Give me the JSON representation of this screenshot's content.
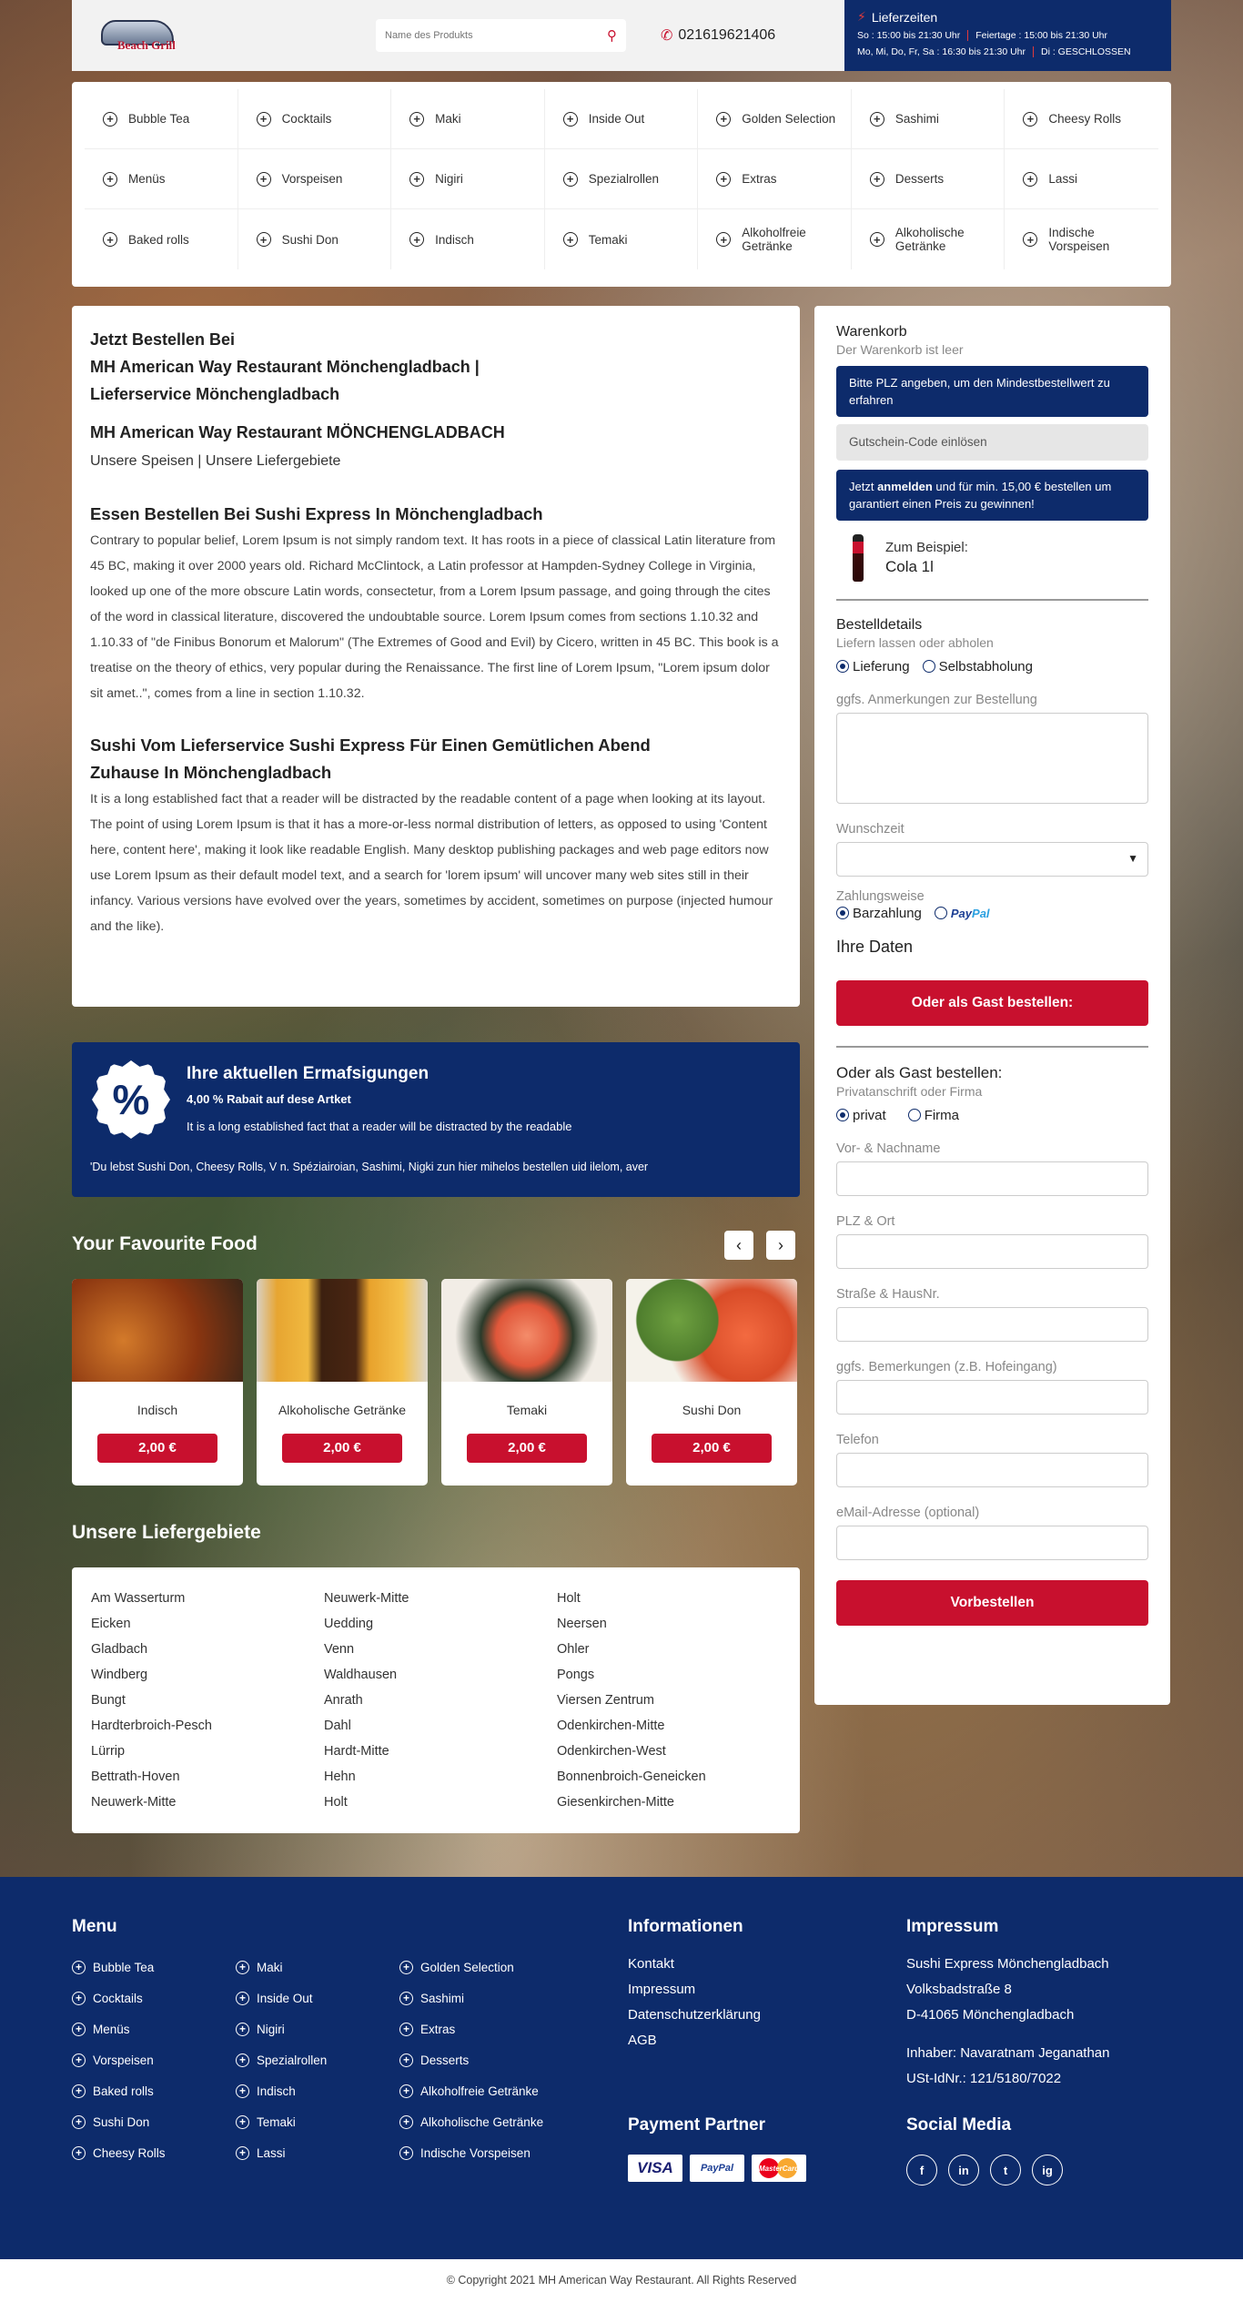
{
  "header": {
    "logo_text": "Beach Grill",
    "search_placeholder": "Name des Produkts",
    "phone": "021619621406",
    "times": {
      "title": "Lieferzeiten",
      "row1_a": "So : 15:00 bis 21:30 Uhr",
      "row1_b": "Feiertage : 15:00 bis 21:30 Uhr",
      "row2_a": "Mo, Mi, Do, Fr, Sa : 16:30 bis 21:30 Uhr",
      "row2_b": "Di : GESCHLOSSEN"
    }
  },
  "categories": [
    "Bubble Tea",
    "Cocktails",
    "Maki",
    "Inside Out",
    "Golden Selection",
    "Sashimi",
    "Cheesy Rolls",
    "Menüs",
    "Vorspeisen",
    "Nigiri",
    "Spezialrollen",
    "Extras",
    "Desserts",
    "Lassi",
    "Baked rolls",
    "Sushi Don",
    "Indisch",
    "Temaki",
    "Alkoholfreie Getränke",
    "Alkoholische Getränke",
    "Indische Vorspeisen"
  ],
  "main": {
    "h1_line1": "Jetzt Bestellen Bei",
    "h1_line2": "MH American Way Restaurant Mönchengladbach |",
    "h1_line3": "Lieferservice Mönchengladbach",
    "h2": "MH American Way Restaurant MÖNCHENGLADBACH",
    "links": "Unsere Speisen | Unsere Liefergebiete",
    "h3": "Essen Bestellen Bei Sushi Express In Mönchengladbach",
    "p1": "Contrary to popular belief, Lorem Ipsum is not simply random text. It has roots in a piece of classical Latin literature from 45 BC, making it over 2000 years old. Richard McClintock, a Latin professor at Hampden-Sydney College in Virginia, looked up one of the more obscure Latin words, consectetur, from a Lorem Ipsum passage, and going through the cites of the word in classical literature, discovered the undoubtable source. Lorem Ipsum comes from sections 1.10.32 and 1.10.33 of \"de Finibus Bonorum et Malorum\" (The Extremes of Good and Evil) by Cicero, written in 45 BC. This book is a treatise on the theory of ethics, very popular during the Renaissance. The first line of Lorem Ipsum, \"Lorem ipsum dolor sit amet..\", comes from a line in section 1.10.32.",
    "h4_line1": "Sushi Vom Lieferservice Sushi Express Für Einen Gemütlichen Abend",
    "h4_line2": "Zuhause In Mönchengladbach",
    "p2": "It is a long established fact that a reader will be distracted by the readable content of a page when looking at its layout. The point of using Lorem Ipsum is that it has a more-or-less normal distribution of letters, as opposed to using 'Content here, content here', making it look like readable English. Many desktop publishing packages and web page editors now use Lorem Ipsum as their default model text, and a search for 'lorem ipsum' will uncover many web sites still in their infancy. Various versions have evolved over the years, sometimes by accident, sometimes on purpose (injected humour and the like)."
  },
  "promo": {
    "badge": "%",
    "title": "Ihre aktuellen Ermafsigungen",
    "sub1": "4,00 % Rabait auf dese Artket",
    "sub2": "It is a long established fact that a reader will be distracted by the readable",
    "sub3": "'Du lebst Sushi Don, Cheesy Rolls, V n. Spéziairoian, Sashimi, Nigki zun hier mihelos bestellen uid ilelom, aver"
  },
  "favourite": {
    "title": "Your Favourite Food",
    "prev": "‹",
    "next": "›",
    "items": [
      {
        "name": "Indisch",
        "price": "2,00 €"
      },
      {
        "name": "Alkoholische Getränke",
        "price": "2,00 €"
      },
      {
        "name": "Temaki",
        "price": "2,00 €"
      },
      {
        "name": "Sushi Don",
        "price": "2,00 €"
      }
    ]
  },
  "areas": {
    "title": "Unsere Liefergebiete",
    "col1": [
      "Am Wasserturm",
      "Eicken",
      "Gladbach",
      "Windberg",
      "Bungt",
      "Hardterbroich-Pesch",
      "Lürrip",
      "Bettrath-Hoven",
      "Neuwerk-Mitte"
    ],
    "col2": [
      "Neuwerk-Mitte",
      "Uedding",
      "Venn",
      "Waldhausen",
      "Anrath",
      "Dahl",
      "Hardt-Mitte",
      "Hehn",
      "Holt"
    ],
    "col3": [
      "Holt",
      "Neersen",
      "Ohler",
      "Pongs",
      "Viersen Zentrum",
      "Odenkirchen-Mitte",
      "Odenkirchen-West",
      "Bonnenbroich-Geneicken",
      "Giesenkirchen-Mitte"
    ]
  },
  "cart": {
    "title": "Warenkorb",
    "empty": "Der Warenkorb ist leer",
    "plz_info": "Bitte PLZ angeben, um den Mindestbestellwert zu erfahren",
    "voucher": "Gutschein-Code einlösen",
    "login_pre": "Jetzt ",
    "login_bold": "anmelden",
    "login_post": " und für min. 15,00 € bestellen um garantiert einen Preis zu  gewinnen!",
    "example_label": "Zum Beispiel:",
    "example_item": "Cola 1l",
    "details_title": "Bestelldetails",
    "details_sub": "Liefern lassen oder abholen",
    "opt_delivery": "Lieferung",
    "opt_pickup": "Selbstabholung",
    "notes_label": "ggfs. Anmerkungen zur Bestellung",
    "time_label": "Wunschzeit",
    "pay_label": "Zahlungsweise",
    "pay_cash": "Barzahlung",
    "pay_paypal_a": "Pay",
    "pay_paypal_b": "Pal",
    "your_data": "Ihre Daten",
    "guest_btn": "Oder als Gast bestellen:",
    "guest_title": "Oder als Gast bestellen:",
    "guest_sub": "Privatanschrift oder Firma",
    "opt_private": "privat",
    "opt_company": "Firma",
    "f_name": "Vor- & Nachname",
    "f_plz": "PLZ & Ort",
    "f_street": "Straße & HausNr.",
    "f_note": "ggfs. Bemerkungen (z.B. Hofeingang)",
    "f_phone": "Telefon",
    "f_email": "eMail-Adresse (optional)",
    "submit": "Vorbestellen"
  },
  "footer": {
    "menu_title": "Menu",
    "menu": [
      "Bubble Tea",
      "Maki",
      "Golden Selection",
      "Cocktails",
      "Inside Out",
      "Sashimi",
      "Menüs",
      "Nigiri",
      "Extras",
      "Vorspeisen",
      "Spezialrollen",
      "Desserts",
      "Baked rolls",
      "Indisch",
      "Alkoholfreie Getränke",
      "Sushi Don",
      "Temaki",
      "Alkoholische Getränke",
      "Cheesy Rolls",
      "Lassi",
      "Indische Vorspeisen"
    ],
    "info_title": "Informationen",
    "info": [
      "Kontakt",
      "Impressum",
      "Datenschutzerklärung",
      "AGB"
    ],
    "imp_title": "Impressum",
    "imp": [
      "Sushi Express Mönchengladbach",
      "Volksbadstraße 8",
      "D-41065 Mönchengladbach",
      "",
      "Inhaber: Navaratnam Jeganathan",
      "USt-IdNr.: 121/5180/7022"
    ],
    "pay_title": "Payment Partner",
    "pay_visa": "VISA",
    "pay_paypal": "PayPal",
    "pay_mc": "MasterCard",
    "social_title": "Social Media",
    "social": [
      "f",
      "in",
      "t",
      "ig"
    ],
    "copyright": "© Copyright 2021 MH American Way Restaurant. All Rights Reserved"
  },
  "colors": {
    "navy": "#0d2b6b",
    "red": "#c8102e"
  }
}
